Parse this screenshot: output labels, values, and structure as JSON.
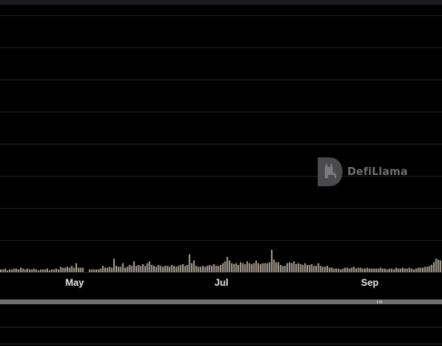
{
  "watermark": {
    "text": "DefiLlama"
  },
  "colors": {
    "background": "#000000",
    "bar": "#a89e8f",
    "grid": "#202020",
    "axis_text": "#e6e6e6",
    "scrollbar": "#6e6e6e",
    "watermark": "#6f6f72"
  },
  "chart_data": {
    "type": "bar",
    "xlabel": "",
    "ylabel": "",
    "x_tick_labels": [
      "May",
      "Jul",
      "Sep"
    ],
    "grid": true,
    "values": [
      3,
      3,
      4,
      2,
      3,
      3,
      4,
      4,
      3,
      5,
      4,
      3,
      4,
      3,
      3,
      4,
      3,
      2,
      3,
      3,
      3,
      4,
      2,
      3,
      3,
      4,
      3,
      6,
      5,
      5,
      6,
      5,
      7,
      5,
      10,
      5,
      5,
      5,
      0,
      0,
      3,
      3,
      3,
      3,
      3,
      4,
      7,
      5,
      5,
      6,
      5,
      15,
      7,
      6,
      6,
      10,
      5,
      6,
      8,
      7,
      12,
      7,
      8,
      7,
      9,
      7,
      10,
      12,
      8,
      7,
      6,
      8,
      7,
      6,
      7,
      7,
      6,
      8,
      7,
      6,
      7,
      8,
      9,
      7,
      8,
      20,
      10,
      13,
      7,
      6,
      6,
      7,
      6,
      7,
      8,
      7,
      9,
      7,
      7,
      8,
      10,
      12,
      17,
      13,
      10,
      9,
      10,
      8,
      11,
      10,
      9,
      12,
      10,
      9,
      10,
      13,
      10,
      9,
      10,
      10,
      10,
      11,
      25,
      14,
      11,
      11,
      8,
      7,
      7,
      10,
      11,
      10,
      12,
      9,
      10,
      9,
      8,
      10,
      8,
      8,
      9,
      7,
      7,
      10,
      7,
      6,
      6,
      7,
      5,
      5,
      4,
      4,
      4,
      3,
      4,
      5,
      5,
      4,
      5,
      6,
      4,
      5,
      5,
      4,
      4,
      5,
      4,
      4,
      4,
      4,
      4,
      5,
      4,
      4,
      3,
      4,
      4,
      3,
      5,
      4,
      4,
      5,
      4,
      4,
      5,
      4,
      3,
      4,
      5,
      5,
      5,
      6,
      6,
      7,
      8,
      11,
      15,
      14,
      13
    ]
  }
}
